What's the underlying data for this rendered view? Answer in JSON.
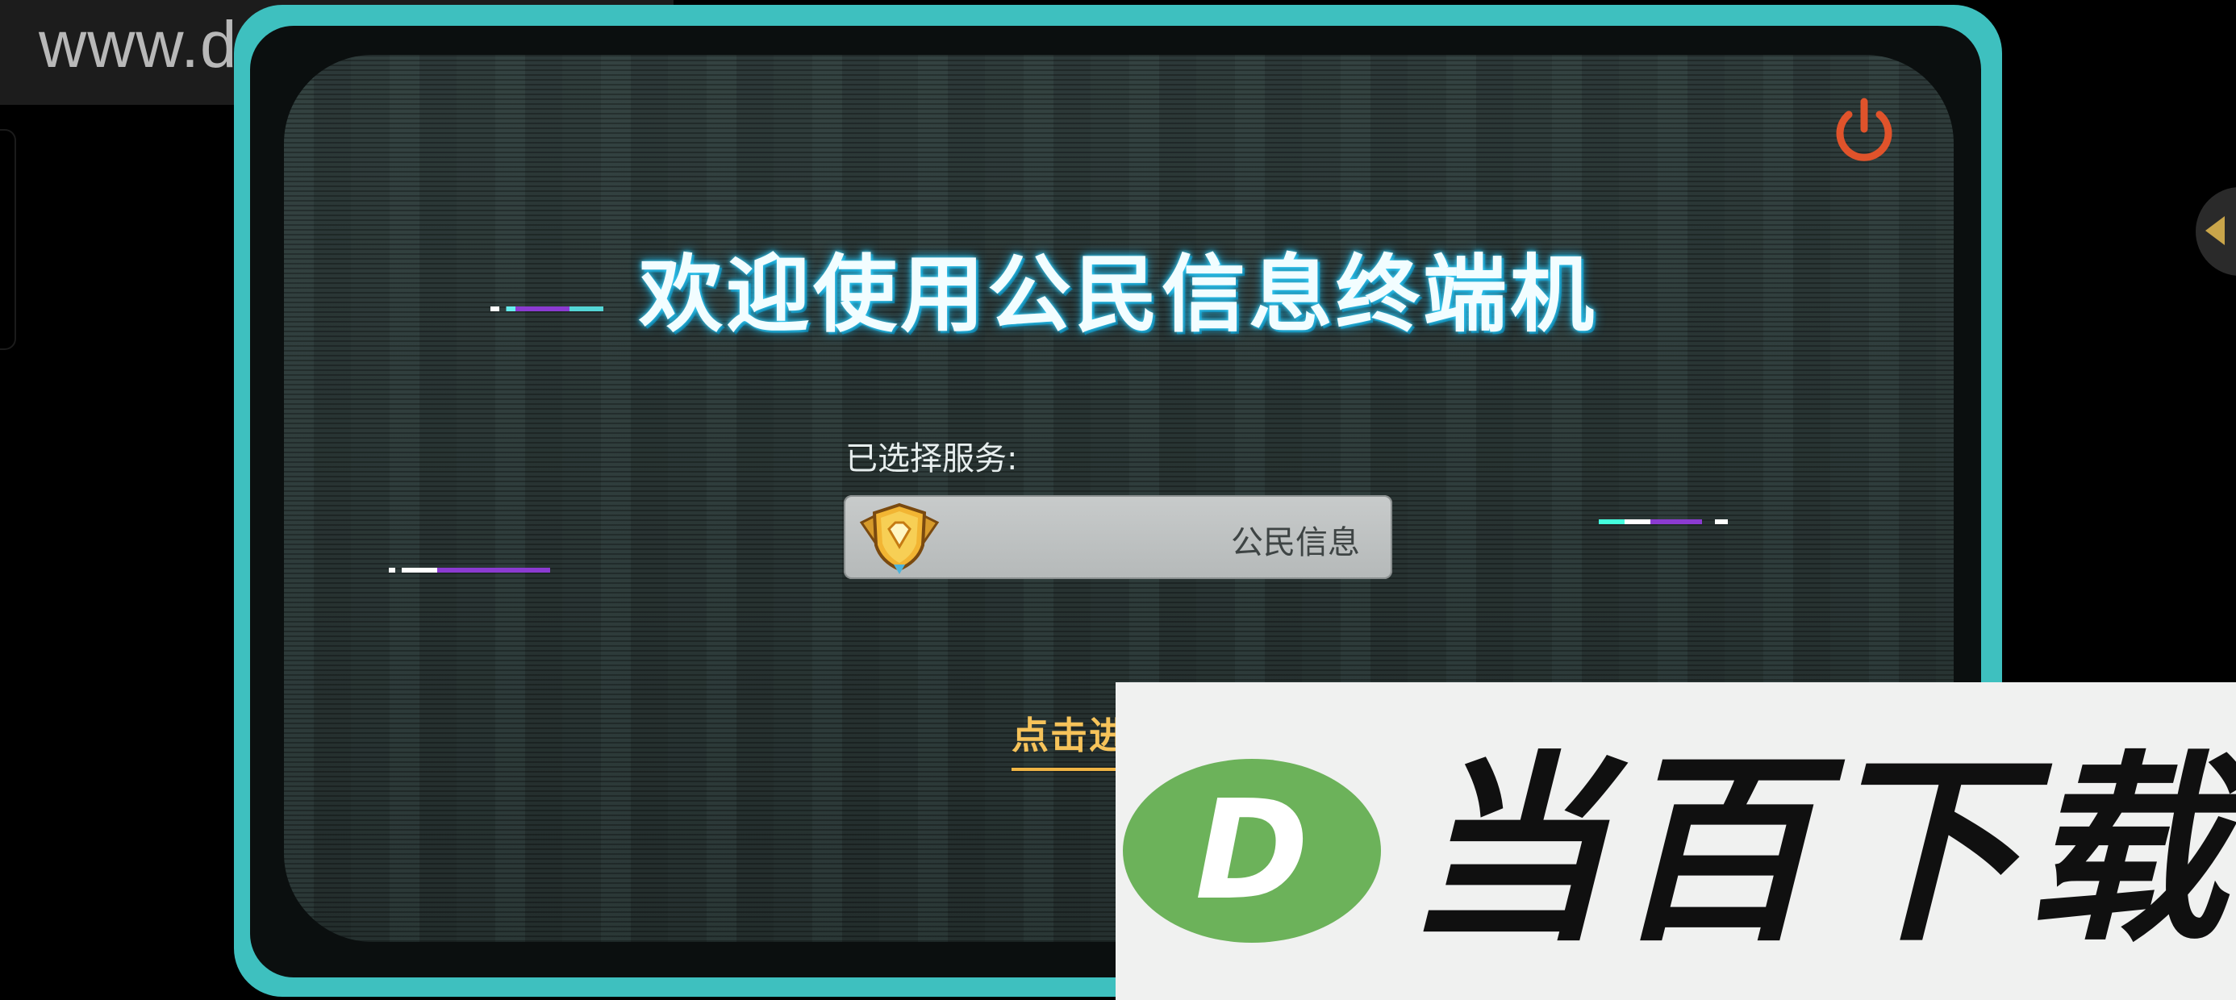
{
  "watermark": {
    "site": "www.downbai.com"
  },
  "terminal": {
    "welcome_title": "欢迎使用公民信息终端机",
    "selected_service_label": "已选择服务:",
    "selected_service_name": "公民信息",
    "enter_prompt": "点击进入..."
  },
  "icons": {
    "power": "power-icon",
    "service_badge": "gold-diamond-shield-badge-icon",
    "side_panel_arrow": "triangle-left-icon"
  },
  "overlay_logo": {
    "letter": "D",
    "brand": "当百下载"
  },
  "colors": {
    "bezel": "#3ec0bf",
    "screen": "#2b3837",
    "title_glow": "#3fd8ff",
    "power_icon": "#e0532b",
    "enter_prompt": "#f6c35a",
    "logo_green": "#6cb25a"
  }
}
